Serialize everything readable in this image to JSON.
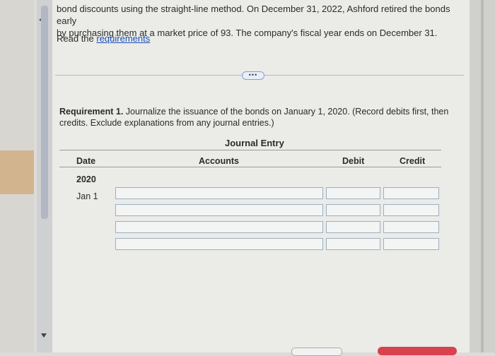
{
  "problem": {
    "intro_line1": "bond discounts using the straight-line method. On December 31, 2022, Ashford retired the bonds early",
    "intro_line2": "by purchasing them at a market price of 93. The company's fiscal year ends on December 31.",
    "read_prefix": "Read the ",
    "requirements_link": "requirements"
  },
  "more_button": "•••",
  "requirement": {
    "label": "Requirement 1.",
    "text": " Journalize the issuance of the bonds on January 1, 2020. (Record debits first, then credits. Exclude explanations from any journal entries.)"
  },
  "journal": {
    "title": "Journal Entry",
    "headers": {
      "date": "Date",
      "accounts": "Accounts",
      "debit": "Debit",
      "credit": "Credit"
    },
    "year": "2020",
    "day": "Jan 1",
    "rows": [
      {
        "account": "",
        "debit": "",
        "credit": ""
      },
      {
        "account": "",
        "debit": "",
        "credit": ""
      },
      {
        "account": "",
        "debit": "",
        "credit": ""
      },
      {
        "account": "",
        "debit": "",
        "credit": ""
      }
    ]
  },
  "colors": {
    "link": "#1a4fb5",
    "submit_button": "#d8414e",
    "input_border": "#9bb0bf"
  }
}
